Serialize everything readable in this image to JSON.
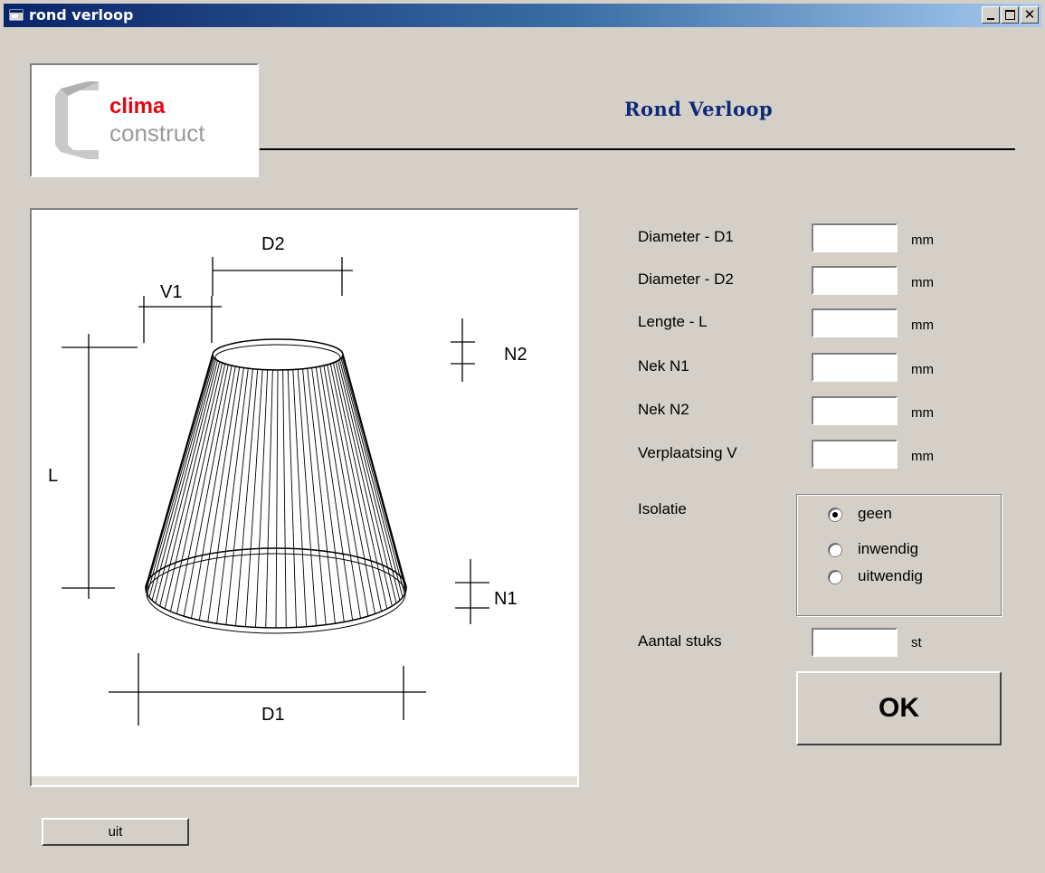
{
  "window": {
    "title": "rond verloop",
    "title_icon": "app-window-icon",
    "controls": {
      "minimize": "_",
      "maximize": "□",
      "close": "×"
    }
  },
  "logo": {
    "line1": "clima",
    "line2": "construct",
    "brand_red": "#e30613",
    "brand_gray": "#9a9a9a"
  },
  "header": {
    "title": "Rond Verloop",
    "title_color": "#102a78"
  },
  "diagram": {
    "labels": {
      "d2": "D2",
      "v1": "V1",
      "n2": "N2",
      "l": "L",
      "n1": "N1",
      "d1": "D1"
    }
  },
  "form": {
    "fields": [
      {
        "label": "Diameter - D1",
        "value": "",
        "unit": "mm"
      },
      {
        "label": "Diameter - D2",
        "value": "",
        "unit": "mm"
      },
      {
        "label": "Lengte - L",
        "value": "",
        "unit": "mm"
      },
      {
        "label": "Nek N1",
        "value": "",
        "unit": "mm"
      },
      {
        "label": "Nek N2",
        "value": "",
        "unit": "mm"
      },
      {
        "label": "Verplaatsing V",
        "value": "",
        "unit": "mm"
      }
    ],
    "isolatie": {
      "label": "Isolatie",
      "options": [
        "geen",
        "inwendig",
        "uitwendig"
      ],
      "selected": "geen"
    },
    "aantal": {
      "label": "Aantal stuks",
      "value": "",
      "unit": "st"
    },
    "ok_label": "OK"
  },
  "footer": {
    "exit_label": "uit"
  }
}
